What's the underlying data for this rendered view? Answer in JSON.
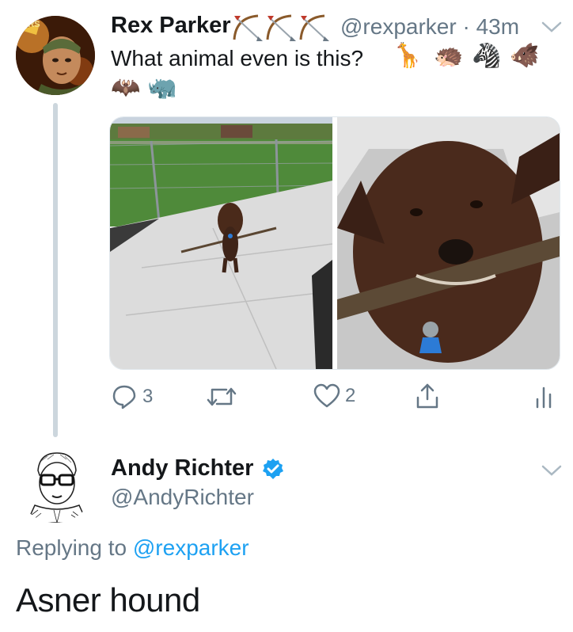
{
  "tweet": {
    "author_name": "Rex Parker",
    "name_suffix_icons": [
      "bow-and-arrow-icon",
      "bow-and-arrow-icon",
      "bow-and-arrow-icon"
    ],
    "handle": "@rexparker",
    "separator": "·",
    "time": "43m",
    "text": "What animal even is this?",
    "emoji": [
      "🦒",
      "🦔",
      "🦓",
      "🐗",
      "🦇",
      "🦏"
    ],
    "actions": {
      "reply_count": "3",
      "retweet_count": "",
      "like_count": "2"
    }
  },
  "reply": {
    "author_name": "Andy Richter",
    "handle": "@AndyRichter",
    "replying_to_label": "Replying to",
    "replying_to_handle": "@rexparker",
    "text": "Asner hound"
  },
  "colors": {
    "secondary_text": "#657786",
    "link": "#1da1f2",
    "verified": "#1da1f2",
    "thread_line": "#ccd6dd"
  }
}
